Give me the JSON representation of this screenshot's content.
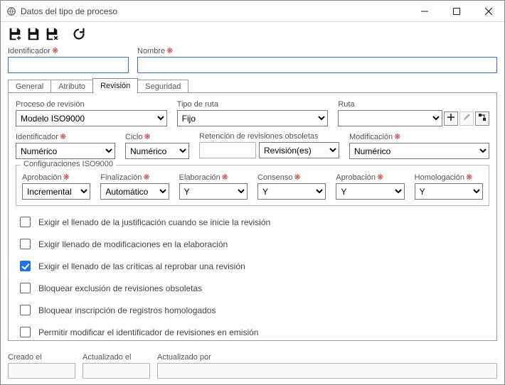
{
  "window": {
    "title": "Datos del tipo de proceso"
  },
  "header": {
    "identificador_label": "Identificador",
    "nombre_label": "Nombre",
    "identificador_value": "",
    "nombre_value": ""
  },
  "tabs": {
    "general": "General",
    "atributo": "Atributo",
    "revision": "Revisión",
    "seguridad": "Seguridad",
    "active": "revision"
  },
  "revision": {
    "proceso_label": "Proceso de revisión",
    "proceso_value": "Modelo ISO9000",
    "tipo_ruta_label": "Tipo de ruta",
    "tipo_ruta_value": "Fijo",
    "ruta_label": "Ruta",
    "ruta_value": "",
    "identificador_label": "Identificador",
    "identificador_value": "Numérico",
    "ciclo_label": "Ciclo",
    "ciclo_value": "Numérico",
    "retencion_label": "Retención de revisiones obsoletas",
    "retencion_qty": "",
    "retencion_unit": "Revisión(es)",
    "modificacion_label": "Modificación",
    "modificacion_value": "Numérico"
  },
  "iso9000": {
    "group_title": "Configuraciones ISO9000",
    "aprobacion1_label": "Aprobación",
    "aprobacion1_value": "Incremental",
    "finalizacion_label": "Finalización",
    "finalizacion_value": "Automático",
    "elaboracion_label": "Elaboración",
    "elaboracion_value": "Y",
    "consenso_label": "Consenso",
    "consenso_value": "Y",
    "aprobacion2_label": "Aprobación",
    "aprobacion2_value": "Y",
    "homologacion_label": "Homologación",
    "homologacion_value": "Y"
  },
  "checks": {
    "c1": {
      "checked": false,
      "label": "Exigir el llenado de la justificación cuando se inicie la revisión"
    },
    "c2": {
      "checked": false,
      "label": "Exigir llenado de modificaciones en la elaboración"
    },
    "c3": {
      "checked": true,
      "label": "Exigir el llenado de las críticas al reprobar una revisión"
    },
    "c4": {
      "checked": false,
      "label": "Bloquear exclusión de revisiones obsoletas"
    },
    "c5": {
      "checked": false,
      "label": "Bloquear inscripción de registros homologados"
    },
    "c6": {
      "checked": false,
      "label": "Permitir modificar el identificador de revisiones en emisión"
    }
  },
  "footer": {
    "creado_label": "Creado el",
    "actualizado_el_label": "Actualizado el",
    "actualizado_por_label": "Actualizado por",
    "creado_value": "",
    "actualizado_el_value": "",
    "actualizado_por_value": ""
  },
  "icons": {
    "required_marker": "❋"
  }
}
